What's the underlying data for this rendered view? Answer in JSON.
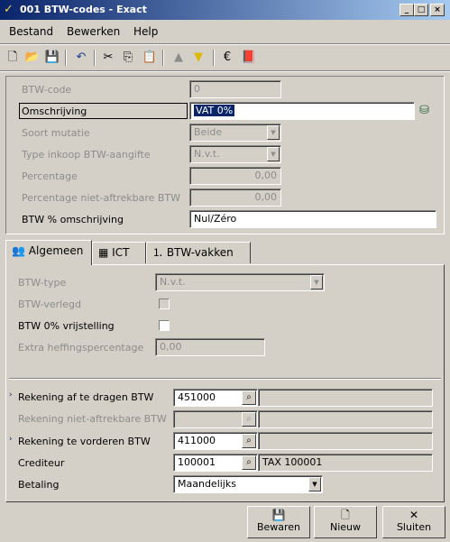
{
  "window": {
    "title": "001 BTW-codes - Exact"
  },
  "menu": [
    "Bestand",
    "Bewerken",
    "Help"
  ],
  "toolbar": {
    "icons": [
      "new-icon",
      "open-icon",
      "save-icon",
      "undo-icon",
      "cut-icon",
      "copy-icon",
      "paste-icon",
      "up-icon",
      "down-icon",
      "euro-icon",
      "book-icon"
    ]
  },
  "header": {
    "btw_code_label": "BTW-code",
    "btw_code_value": "0",
    "omschrijving_label": "Omschrijving",
    "omschrijving_value": "VAT 0%",
    "soort_mutatie_label": "Soort mutatie",
    "soort_mutatie_value": "Beide",
    "type_inkoop_label": "Type inkoop BTW-aangifte",
    "type_inkoop_value": "N.v.t.",
    "percentage_label": "Percentage",
    "percentage_value": "0,00",
    "perc_niet_label": "Percentage niet-aftrekbare BTW",
    "perc_niet_value": "0,00",
    "btw_omschr_label": "BTW % omschrijving",
    "btw_omschr_value": "Nul/Zéro"
  },
  "tabs": [
    "Algemeen",
    "ICT",
    "BTW-vakken"
  ],
  "general": {
    "btw_type_label": "BTW-type",
    "btw_type_value": "N.v.t.",
    "btw_verlegd_label": "BTW-verlegd",
    "btw_vrijstelling_label": "BTW 0% vrijstelling",
    "extra_label": "Extra heffingspercentage",
    "extra_value": "0,00"
  },
  "accounts": {
    "af_te_dragen_label": "Rekening af te dragen BTW",
    "af_te_dragen_value": "451000",
    "niet_aftrekbare_label": "Rekening niet-aftrekbare BTW",
    "te_vorderen_label": "Rekening te vorderen BTW",
    "te_vorderen_value": "411000",
    "crediteur_label": "Crediteur",
    "crediteur_value": "100001",
    "crediteur_desc": "TAX 100001",
    "betaling_label": "Betaling",
    "betaling_value": "Maandelijks"
  },
  "buttons": {
    "save": "Bewaren",
    "new": "Nieuw",
    "close": "Sluiten"
  }
}
